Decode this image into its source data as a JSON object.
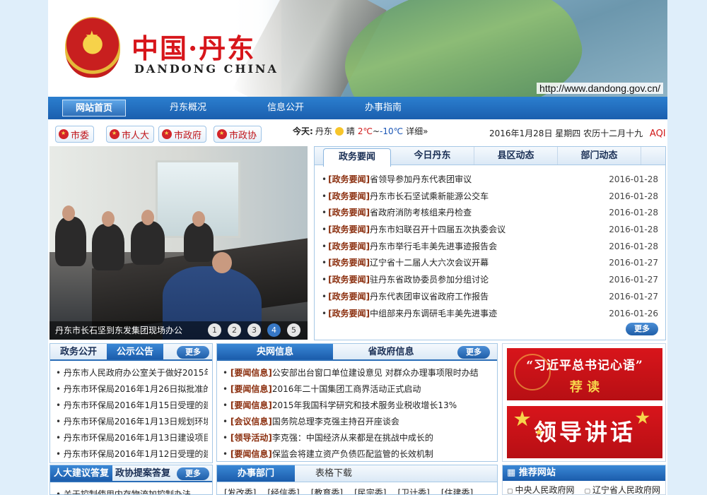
{
  "banner": {
    "title_cn": "中国·丹东",
    "title_en": "DANDONG CHINA",
    "url": "http://www.dandong.gov.cn/"
  },
  "nav": {
    "items": [
      "网站首页",
      "丹东概况",
      "信息公开",
      "办事指南"
    ]
  },
  "quick_links": [
    "市委",
    "市人大",
    "市政府",
    "市政协"
  ],
  "weather": {
    "label": "今天:",
    "city": "丹东",
    "icon": "sun-icon",
    "condition": "晴",
    "high": "2℃",
    "sep": "~",
    "low": "-10℃",
    "detail": "详细»"
  },
  "date_line": "2016年1月28日 星期四 农历十二月十九",
  "aqi": "AQI",
  "slideshow": {
    "caption": "丹东市长石坚到东发集团现场办公",
    "pages": [
      "1",
      "2",
      "3",
      "4",
      "5"
    ],
    "active_page": 4
  },
  "news": {
    "tabs": [
      "政务要闻",
      "今日丹东",
      "县区动态",
      "部门动态"
    ],
    "items": [
      {
        "tag": "[政务要闻]",
        "title": "省领导参加丹东代表团审议",
        "date": "2016-01-28"
      },
      {
        "tag": "[政务要闻]",
        "title": "丹东市长石坚试乘新能源公交车",
        "date": "2016-01-28"
      },
      {
        "tag": "[政务要闻]",
        "title": "省政府消防考核组来丹检查",
        "date": "2016-01-28"
      },
      {
        "tag": "[政务要闻]",
        "title": "丹东市妇联召开十四届五次执委会议",
        "date": "2016-01-28"
      },
      {
        "tag": "[政务要闻]",
        "title": "丹东市举行毛丰美先进事迹报告会",
        "date": "2016-01-28"
      },
      {
        "tag": "[政务要闻]",
        "title": "辽宁省十二届人大六次会议开幕",
        "date": "2016-01-27"
      },
      {
        "tag": "[政务要闻]",
        "title": "驻丹东省政协委员参加分组讨论",
        "date": "2016-01-27"
      },
      {
        "tag": "[政务要闻]",
        "title": "丹东代表团审议省政府工作报告",
        "date": "2016-01-27"
      },
      {
        "tag": "[政务要闻]",
        "title": "中组部来丹东调研毛丰美先进事迹",
        "date": "2016-01-26"
      }
    ],
    "more": "更多"
  },
  "gov_open": {
    "tabs": [
      "政务公开",
      "公示公告"
    ],
    "more": "更多",
    "items": [
      "丹东市人民政府办公室关于做好2015年",
      "丹东市环保局2016年1月26日拟批准的",
      "丹东市环保局2016年1月15日受理的建",
      "丹东市环保局2016年1月13日规划环境",
      "丹东市环保局2016年1月13日建设项目",
      "丹东市环保局2016年1月12日受理的建"
    ]
  },
  "proposal": {
    "tabs": [
      "人大建议答复",
      "政协提案答复"
    ],
    "more": "更多",
    "items": [
      "关于控制使用内存物流加控制办法"
    ]
  },
  "central_info": {
    "tabs": [
      "央网信息",
      "省政府信息"
    ],
    "more": "更多",
    "items": [
      {
        "tag": "[要闻信息]",
        "title": "公安部出台窗口单位建设意见 对群众办理事项限时办结"
      },
      {
        "tag": "[要闻信息]",
        "title": "2016年二十国集团工商界活动正式启动"
      },
      {
        "tag": "[要闻信息]",
        "title": "2015年我国科学研究和技术服务业税收增长13%"
      },
      {
        "tag": "[会议信息]",
        "title": "国务院总理李克强主持召开座谈会"
      },
      {
        "tag": "[领导活动]",
        "title": "李克强：中国经济从来都是在挑战中成长的"
      },
      {
        "tag": "[要闻信息]",
        "title": "保监会将建立资产负债匹配监管的长效机制"
      }
    ]
  },
  "service": {
    "tabs": [
      "办事部门",
      "表格下载"
    ],
    "items": [
      "[发改委]",
      "[经信委]",
      "[教育委]",
      "[民宗委]",
      "[卫计委]",
      "[住建委]"
    ]
  },
  "promo": {
    "banner1_top": "“习近平总书记心语”",
    "banner1_bottom": "荐  读",
    "banner2": "领导讲话"
  },
  "recommended": {
    "title": "推荐网站",
    "links": [
      "中央人民政府网",
      "辽宁省人民政府网"
    ]
  }
}
